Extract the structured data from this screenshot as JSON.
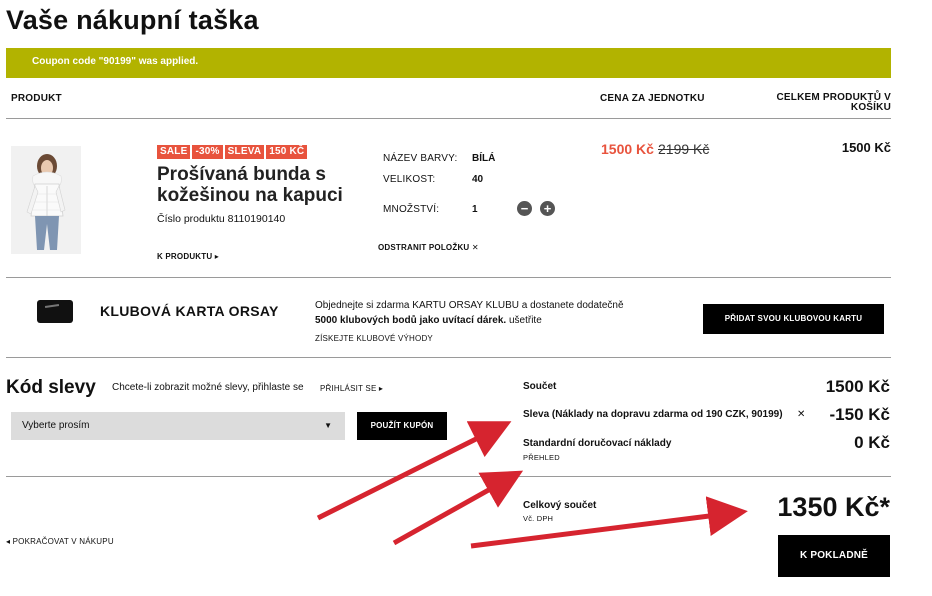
{
  "page_title": "Vaše nákupní taška",
  "coupon_message": "Coupon code \"90199\" was applied.",
  "table_headers": {
    "product": "PRODUKT",
    "unit_price": "CENA ZA JEDNOTKU",
    "total": "CELKEM PRODUKTŮ V KOŠÍKU"
  },
  "item": {
    "badges": [
      "SALE",
      "-30%",
      "SLEVA",
      "150 KČ"
    ],
    "name": "Prošívaná bunda s kožešinou na kapuci",
    "product_number": "Číslo produktu 8110190140",
    "product_link": "K PRODUKTU ▸",
    "color_label": "NÁZEV BARVY:",
    "color_value": "BÍLÁ",
    "size_label": "VELIKOST:",
    "size_value": "40",
    "qty_label": "MNOŽSTVÍ:",
    "qty_value": "1",
    "qty_minus": "−",
    "qty_plus": "+",
    "remove_link": "ODSTRANIT POLOŽKU ✕",
    "price_sale": "1500 Kč",
    "price_old": "2199 Kč",
    "line_total": "1500 Kč"
  },
  "club": {
    "title": "KLUBOVÁ KARTA ORSAY",
    "text_part1": "Objednejte si zdarma KARTU ORSAY KLUBU a dostanete dodatečně ",
    "text_bold": "5000 klubových bodů jako uvítací dárek.",
    "text_part2": " ušetřite",
    "link": "ZÍSKEJTE KLUBOVÉ VÝHODY",
    "button": "PŘIDAT SVOU KLUBOVOU KARTU"
  },
  "discount": {
    "title": "Kód slevy",
    "hint": "Chcete-li zobrazit možné slevy, přihlaste se",
    "login_link": "PŘIHLÁSIT SE ▸",
    "select_placeholder": "Vyberte prosím",
    "apply_button": "POUŽÍT KUPÓN"
  },
  "summary": {
    "subtotal_label": "Součet",
    "subtotal_value": "1500 Kč",
    "discount_label": "Sleva (Náklady na dopravu zdarma od 190 CZK, 90199)",
    "discount_remove": "✕",
    "discount_value": "-150 Kč",
    "shipping_label": "Standardní doručovací náklady",
    "shipping_link": "PŘEHLED",
    "shipping_value": "0 Kč",
    "grand_label": "Celkový součet",
    "grand_sub": "Vč. DPH",
    "grand_value": "1350 Kč*"
  },
  "continue_link": "◂ POKRAČOVAT V NÁKUPU",
  "checkout_button": "K POKLADNĚ",
  "colors": {
    "coupon_bar": "#b2b300",
    "sale_red": "#e8533d",
    "annotation_arrow": "#d6242f"
  }
}
